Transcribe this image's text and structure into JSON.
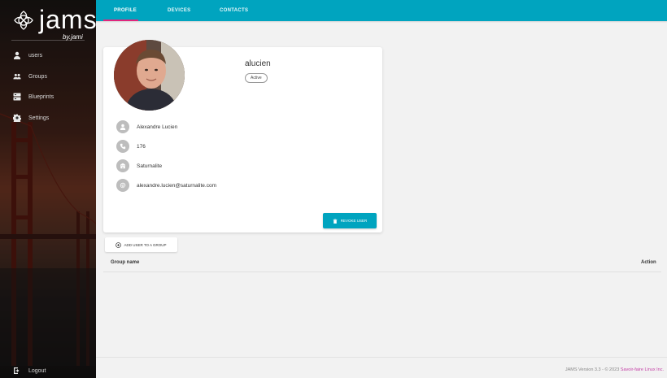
{
  "app": {
    "logo_text": "jams",
    "logo_sub": "by.jami"
  },
  "sidebar": {
    "items": [
      {
        "label": "users",
        "icon": "person-icon"
      },
      {
        "label": "Groups",
        "icon": "group-icon"
      },
      {
        "label": "Blueprints",
        "icon": "blueprint-icon"
      },
      {
        "label": "Settings",
        "icon": "gear-icon"
      }
    ],
    "logout_label": "Logout"
  },
  "header": {
    "tabs": [
      {
        "label": "PROFILE",
        "active": true
      },
      {
        "label": "DEVICES",
        "active": false
      },
      {
        "label": "CONTACTS",
        "active": false
      }
    ],
    "accent": "#00a4bf",
    "tab_indicator": "#e0267d"
  },
  "profile": {
    "username": "alucien",
    "status": "Active",
    "full_name": "Alexandre Lucien",
    "extension": "176",
    "company": "Saturnalite",
    "email": "alexandre.lucien@saturnalite.com",
    "revoke_label": "REVOKE USER"
  },
  "groups": {
    "add_label": "ADD USER TO A GROUP",
    "columns": [
      "Group name",
      "Action"
    ]
  },
  "footer": {
    "version_text": "JAMS Version 3.3 - © 2023 ",
    "company_link": "Savoir-faire Linux Inc."
  }
}
